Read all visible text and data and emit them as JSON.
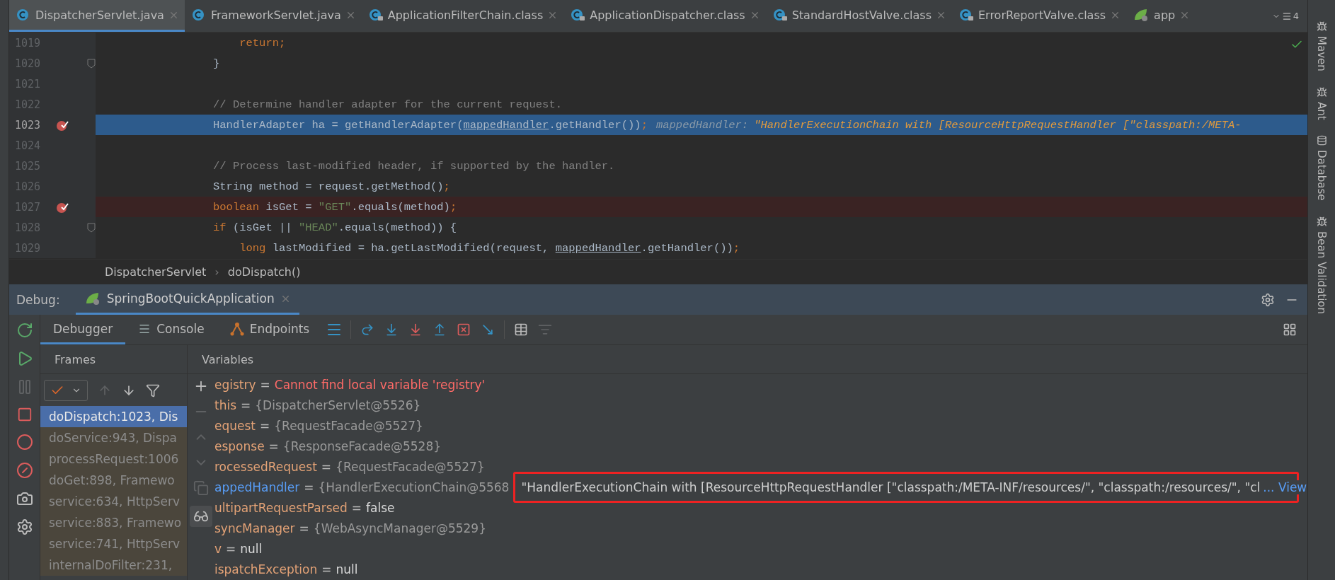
{
  "tabs": [
    {
      "label": "DispatcherServlet.java",
      "kind": "java",
      "selected": true
    },
    {
      "label": "FrameworkServlet.java",
      "kind": "java",
      "selected": false
    },
    {
      "label": "ApplicationFilterChain.class",
      "kind": "class",
      "selected": false
    },
    {
      "label": "ApplicationDispatcher.class",
      "kind": "class",
      "selected": false
    },
    {
      "label": "StandardHostValve.class",
      "kind": "class",
      "selected": false
    },
    {
      "label": "ErrorReportValve.class",
      "kind": "class",
      "selected": false
    },
    {
      "label": "app",
      "kind": "spring",
      "selected": false
    }
  ],
  "tab_count": "4",
  "editor": {
    "lines": [
      {
        "number": "1019",
        "breakpoint": false,
        "fold": false,
        "current": false,
        "code": [
          {
            "kind": "keyword",
            "t": "    return;"
          }
        ]
      },
      {
        "number": "1020",
        "breakpoint": false,
        "fold": true,
        "current": false,
        "code": [
          {
            "kind": "plain",
            "t": "}"
          }
        ]
      },
      {
        "number": "1021",
        "breakpoint": false,
        "fold": false,
        "current": false
      },
      {
        "number": "1022",
        "breakpoint": false,
        "fold": false,
        "current": false,
        "code": [
          {
            "kind": "comment",
            "t": "// Determine handler adapter for the current request."
          }
        ]
      },
      {
        "number": "1023",
        "breakpoint": true,
        "fold": false,
        "current": true,
        "code": [
          {
            "kind": "plain",
            "t": "HandlerAdapter ha = getHandlerAdapter("
          },
          {
            "kind": "ref",
            "t": "mappedHandler"
          },
          {
            "kind": "plain",
            "t": ".getHandler())"
          },
          {
            "kind": "keyword",
            "t": ";"
          }
        ],
        "hint": {
          "label": "mappedHandler:",
          "value": "\"HandlerExecutionChain with [ResourceHttpRequestHandler [\"classpath:/META-"
        }
      },
      {
        "number": "1024",
        "breakpoint": false,
        "fold": false,
        "current": false
      },
      {
        "number": "1025",
        "breakpoint": false,
        "fold": false,
        "current": false,
        "code": [
          {
            "kind": "comment",
            "t": "// Process last-modified header, if supported by the handler."
          }
        ]
      },
      {
        "number": "1026",
        "breakpoint": false,
        "fold": false,
        "current": false,
        "code": [
          {
            "kind": "plain",
            "t": "String method = request.getMethod()"
          },
          {
            "kind": "keyword",
            "t": ";"
          }
        ]
      },
      {
        "number": "1027",
        "breakpoint": true,
        "fold": false,
        "current": false,
        "code": [
          {
            "kind": "keyword",
            "t": "boolean "
          },
          {
            "kind": "plain",
            "t": "isGet = "
          },
          {
            "kind": "string",
            "t": "\"GET\""
          },
          {
            "kind": "plain",
            "t": ".equals(method)"
          },
          {
            "kind": "keyword",
            "t": ";"
          }
        ]
      },
      {
        "number": "1028",
        "breakpoint": false,
        "fold": true,
        "current": false,
        "code": [
          {
            "kind": "keyword",
            "t": "if "
          },
          {
            "kind": "plain",
            "t": "(isGet || "
          },
          {
            "kind": "string",
            "t": "\"HEAD\""
          },
          {
            "kind": "plain",
            "t": ".equals(method)) {"
          }
        ]
      },
      {
        "number": "1029",
        "breakpoint": false,
        "fold": false,
        "current": false,
        "code": [
          {
            "kind": "keyword",
            "t": "    long "
          },
          {
            "kind": "plain",
            "t": "lastModified = ha.getLastModified(request, "
          },
          {
            "kind": "ref",
            "t": "mappedHandler"
          },
          {
            "kind": "plain",
            "t": ".getHandler())"
          },
          {
            "kind": "keyword",
            "t": ";"
          }
        ]
      }
    ]
  },
  "breadcrumbs": [
    "DispatcherServlet",
    "doDispatch()"
  ],
  "breadcrumb_separator": "›",
  "right_tools": [
    "Maven",
    "Ant",
    "Database",
    "Bean Validation"
  ],
  "debug": {
    "label": "Debug:",
    "session": "SpringBootQuickApplication",
    "tabs": [
      {
        "label": "Debugger",
        "kind": "debugger",
        "selected": true
      },
      {
        "label": "Console",
        "kind": "console",
        "selected": false
      },
      {
        "label": "Endpoints",
        "kind": "endpoints",
        "selected": false
      }
    ],
    "frames_title": "Frames",
    "variables_title": "Variables",
    "assignment_sign": "=",
    "frames": [
      {
        "label": "doDispatch:1023, Dis",
        "selected": true
      },
      {
        "label": "doService:943, Dispa",
        "selected": false
      },
      {
        "label": "processRequest:1006",
        "selected": false
      },
      {
        "label": "doGet:898, Framewo",
        "selected": false
      },
      {
        "label": "service:634, HttpServ",
        "selected": false
      },
      {
        "label": "service:883, Framewo",
        "selected": false
      },
      {
        "label": "service:741, HttpServ",
        "selected": false
      },
      {
        "label": "internalDoFilter:231,",
        "selected": false
      }
    ],
    "variables": [
      {
        "name": "egistry",
        "value": "Cannot find local variable 'registry'",
        "kind": "error",
        "changed": false
      },
      {
        "name": "this",
        "value": "{DispatcherServlet@5526}",
        "kind": "object",
        "changed": false
      },
      {
        "name": "equest",
        "value": "{RequestFacade@5527}",
        "kind": "object",
        "changed": false
      },
      {
        "name": "esponse",
        "value": "{ResponseFacade@5528}",
        "kind": "object",
        "changed": false
      },
      {
        "name": "rocessedRequest",
        "value": "{RequestFacade@5527}",
        "kind": "object",
        "changed": false
      },
      {
        "name": "appedHandler",
        "value": "{HandlerExecutionChain@5568",
        "kind": "object",
        "changed": true,
        "preview": "\"HandlerExecutionChain with [ResourceHttpRequestHandler [\"classpath:/META-INF/resources/\", \"classpath:/resources/\", \"cl",
        "preview_link": "... View"
      },
      {
        "name": "ultipartRequestParsed",
        "value": "false",
        "kind": "literal",
        "changed": false
      },
      {
        "name": "syncManager",
        "value": "{WebAsyncManager@5529}",
        "kind": "object",
        "changed": false
      },
      {
        "name": "v",
        "value": "null",
        "kind": "literal",
        "changed": false
      },
      {
        "name": "ispatchException",
        "value": "null",
        "kind": "literal",
        "changed": false
      }
    ]
  }
}
